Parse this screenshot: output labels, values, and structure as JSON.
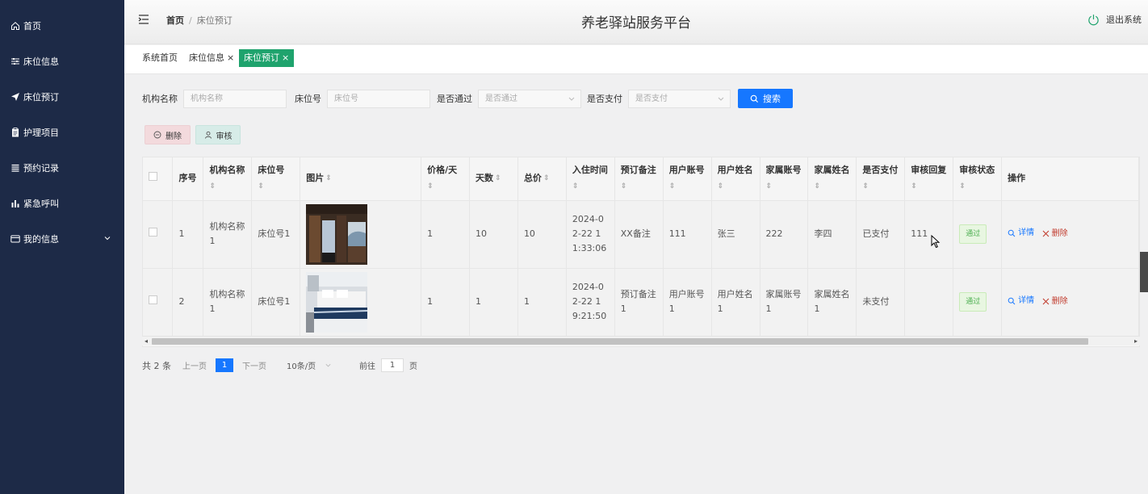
{
  "sidebar": {
    "items": [
      {
        "label": "首页",
        "icon": "home-icon"
      },
      {
        "label": "床位信息",
        "icon": "sliders-icon"
      },
      {
        "label": "床位预订",
        "icon": "send-icon"
      },
      {
        "label": "护理项目",
        "icon": "clipboard-icon"
      },
      {
        "label": "预约记录",
        "icon": "list-icon"
      },
      {
        "label": "紧急呼叫",
        "icon": "bar-chart-icon"
      },
      {
        "label": "我的信息",
        "icon": "card-icon"
      }
    ]
  },
  "header": {
    "breadcrumb_home": "首页",
    "breadcrumb_sep": "/",
    "breadcrumb_current": "床位预订",
    "title": "养老驿站服务平台",
    "logout": "退出系统"
  },
  "tabs": [
    {
      "label": "系统首页",
      "closable": false
    },
    {
      "label": "床位信息",
      "closable": true
    },
    {
      "label": "床位预订",
      "closable": true,
      "active": true
    }
  ],
  "tab_close": "×",
  "search": {
    "org_label": "机构名称",
    "org_placeholder": "机构名称",
    "bed_label": "床位号",
    "bed_placeholder": "床位号",
    "pass_label": "是否通过",
    "pass_placeholder": "是否通过",
    "paid_label": "是否支付",
    "paid_placeholder": "是否支付",
    "button": "搜索"
  },
  "actions": {
    "delete": "删除",
    "audit": "审核"
  },
  "table": {
    "headers": [
      "序号",
      "机构名称",
      "床位号",
      "图片",
      "价格/天",
      "天数",
      "总价",
      "入住时间",
      "预订备注",
      "用户账号",
      "用户姓名",
      "家属账号",
      "家属姓名",
      "是否支付",
      "审核回复",
      "审核状态",
      "操作"
    ],
    "rows": [
      {
        "no": "1",
        "org": "机构名称1",
        "bed": "床位号1",
        "price": "1",
        "days": "10",
        "total": "10",
        "checkin": "2024-02-22 11:33:06",
        "remark": "XX备注",
        "user_account": "111",
        "user_name": "张三",
        "family_account": "222",
        "family_name": "李四",
        "paid": "已支付",
        "reply": "111",
        "status": "通过"
      },
      {
        "no": "2",
        "org": "机构名称1",
        "bed": "床位号1",
        "price": "1",
        "days": "1",
        "total": "1",
        "checkin": "2024-02-22 19:21:50",
        "remark": "预订备注1",
        "user_account": "用户账号1",
        "user_name": "用户姓名1",
        "family_account": "家属账号1",
        "family_name": "家属姓名1",
        "paid": "未支付",
        "reply": "",
        "status": "通过"
      }
    ],
    "op_detail": "详情",
    "op_delete": "删除"
  },
  "pager": {
    "total": "共 2 条",
    "prev": "上一页",
    "current": "1",
    "next": "下一页",
    "size": "10条/页",
    "goto_prefix": "前往",
    "goto_value": "1",
    "goto_suffix": "页"
  },
  "colors": {
    "sidebar": "#1d2a47",
    "active_tab": "#1fa36d",
    "primary": "#1677ff",
    "danger": "#c0392b"
  }
}
